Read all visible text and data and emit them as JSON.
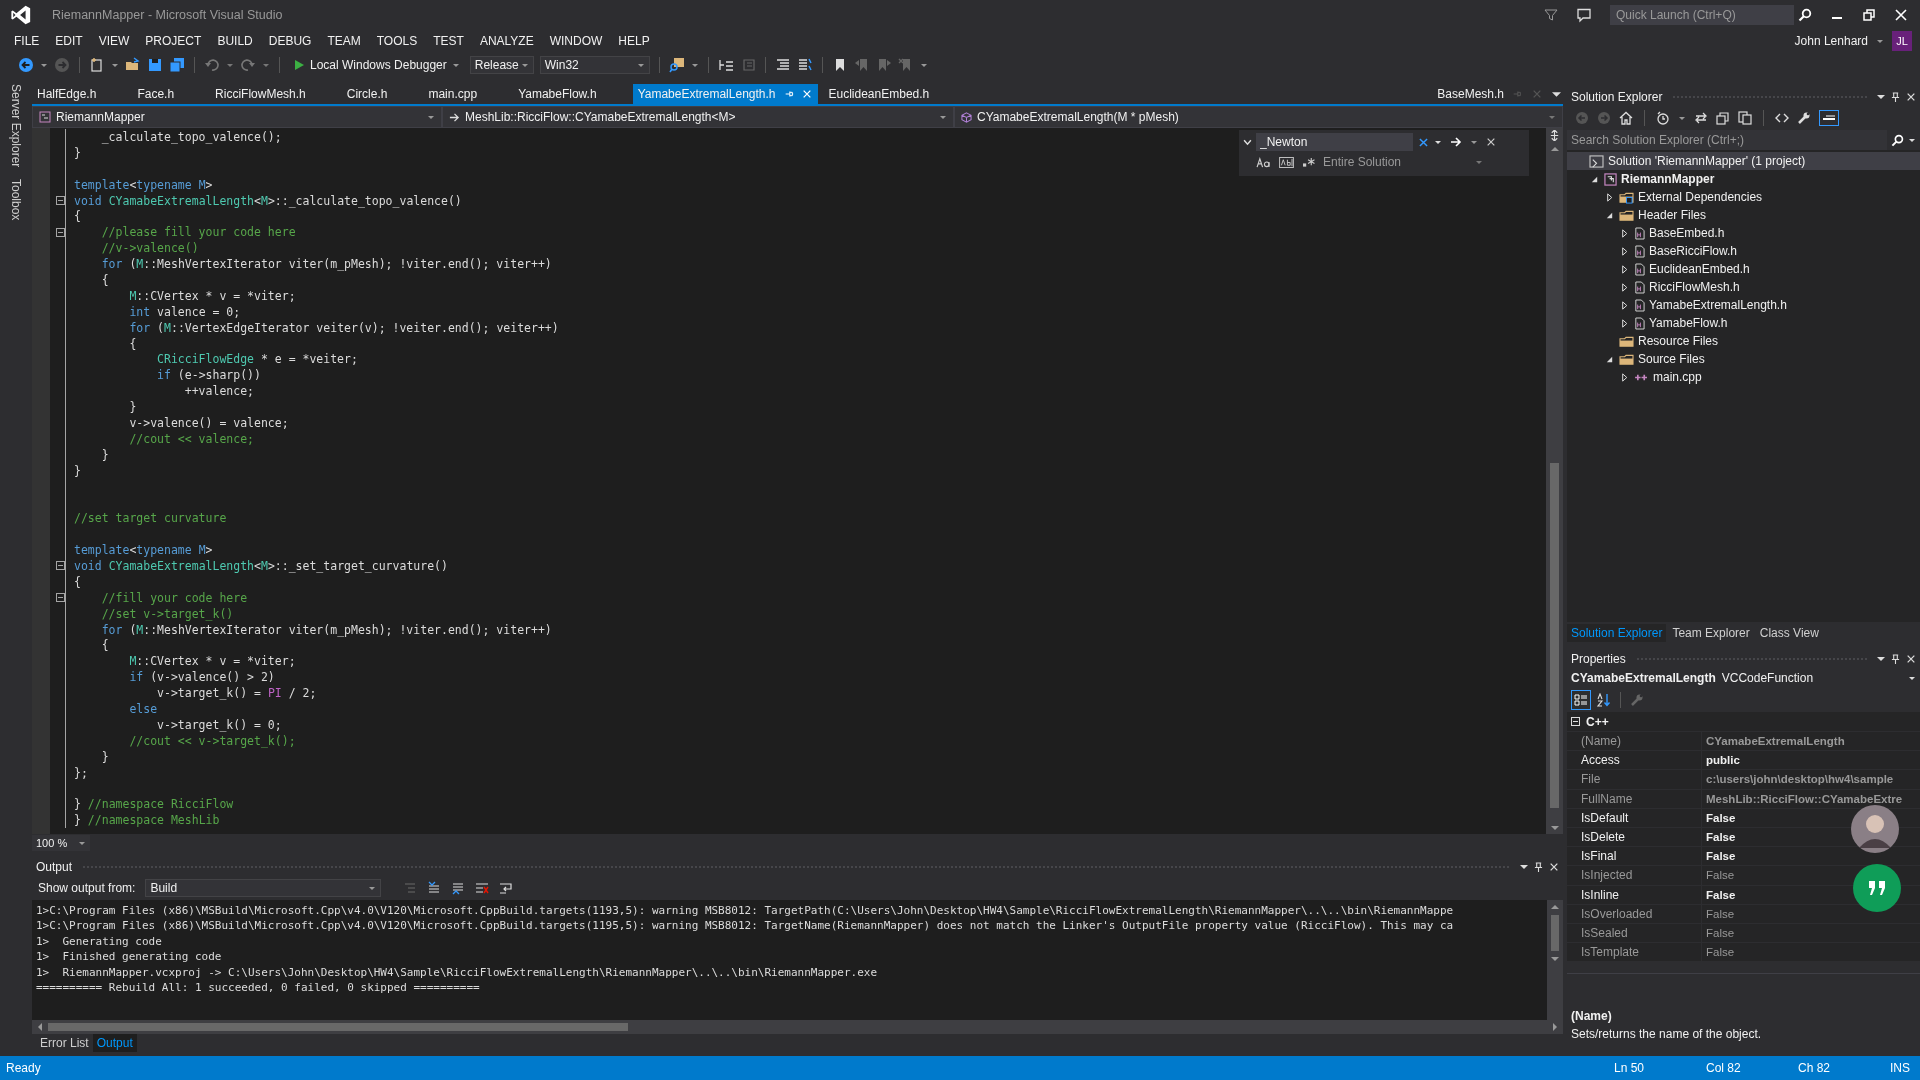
{
  "window": {
    "title": "RiemannMapper - Microsoft Visual Studio"
  },
  "menu": [
    "FILE",
    "EDIT",
    "VIEW",
    "PROJECT",
    "BUILD",
    "DEBUG",
    "TEAM",
    "TOOLS",
    "TEST",
    "ANALYZE",
    "WINDOW",
    "HELP"
  ],
  "toolbar": {
    "debugger": "Local Windows Debugger",
    "configuration": "Release",
    "platform": "Win32"
  },
  "quick_launch": {
    "placeholder": "Quick Launch (Ctrl+Q)"
  },
  "user": {
    "name": "John Lenhard",
    "initials": "JL"
  },
  "side_tabs": [
    "Server Explorer",
    "Toolbox"
  ],
  "editor_tabs": [
    {
      "label": "HalfEdge.h",
      "selected": false
    },
    {
      "label": "Face.h",
      "selected": false
    },
    {
      "label": "RicciFlowMesh.h",
      "selected": false
    },
    {
      "label": "Circle.h",
      "selected": false
    },
    {
      "label": "main.cpp",
      "selected": false
    },
    {
      "label": "YamabeFlow.h",
      "selected": false
    },
    {
      "label": "YamabeExtremalLength.h",
      "selected": true
    },
    {
      "label": "EuclideanEmbed.h",
      "selected": false
    }
  ],
  "preview_tab": {
    "label": "BaseMesh.h"
  },
  "nav_bar": {
    "project": "RiemannMapper",
    "scope": "MeshLib::RicciFlow::CYamabeExtremalLength<M>",
    "member": "CYamabeExtremalLength(M * pMesh)"
  },
  "find": {
    "value": "_Newton",
    "scope": "Entire Solution"
  },
  "code": [
    {
      "fold": false,
      "segs": [
        {
          "text": "    _calculate_topo_valence();",
          "kind": "plain"
        }
      ]
    },
    {
      "fold": false,
      "segs": [
        {
          "text": "}",
          "kind": "plain"
        }
      ]
    },
    {
      "fold": false
    },
    {
      "fold": false,
      "segs": [
        {
          "text": "template",
          "kind": "keyword"
        },
        {
          "text": "<",
          "kind": "plain"
        },
        {
          "text": "typename M",
          "kind": "keyword"
        },
        {
          "text": ">",
          "kind": "plain"
        }
      ]
    },
    {
      "fold": true,
      "segs": [
        {
          "text": "void",
          "kind": "keyword"
        },
        {
          "text": " CYamabeExtremalLength",
          "kind": "type"
        },
        {
          "text": "<",
          "kind": "plain"
        },
        {
          "text": "M",
          "kind": "type"
        },
        {
          "text": ">::_calculate_topo_valence()",
          "kind": "plain"
        }
      ]
    },
    {
      "fold": false,
      "segs": [
        {
          "text": "{",
          "kind": "plain"
        }
      ]
    },
    {
      "fold": true,
      "segs": [
        {
          "text": "    //please fill your code here",
          "kind": "comment"
        }
      ]
    },
    {
      "fold": false,
      "segs": [
        {
          "text": "    //v->valence()",
          "kind": "comment"
        }
      ]
    },
    {
      "fold": false,
      "segs": [
        {
          "text": "    for",
          "kind": "keyword"
        },
        {
          "text": " (",
          "kind": "plain"
        },
        {
          "text": "M",
          "kind": "type"
        },
        {
          "text": "::MeshVertexIterator viter(m_pMesh); !viter.end(); viter++)",
          "kind": "plain"
        }
      ]
    },
    {
      "fold": false,
      "segs": [
        {
          "text": "    {",
          "kind": "plain"
        }
      ]
    },
    {
      "fold": false,
      "segs": [
        {
          "text": "        M",
          "kind": "type"
        },
        {
          "text": "::CVertex * v = *viter;",
          "kind": "plain"
        }
      ]
    },
    {
      "fold": false,
      "segs": [
        {
          "text": "        int",
          "kind": "keyword"
        },
        {
          "text": " valence = 0;",
          "kind": "plain"
        }
      ]
    },
    {
      "fold": false,
      "segs": [
        {
          "text": "        for",
          "kind": "keyword"
        },
        {
          "text": " (",
          "kind": "plain"
        },
        {
          "text": "M",
          "kind": "type"
        },
        {
          "text": "::VertexEdgeIterator veiter(v); !veiter.end(); veiter++)",
          "kind": "plain"
        }
      ]
    },
    {
      "fold": false,
      "segs": [
        {
          "text": "        {",
          "kind": "plain"
        }
      ]
    },
    {
      "fold": false,
      "segs": [
        {
          "text": "            CRicciFlowEdge",
          "kind": "type"
        },
        {
          "text": " * e = *veiter;",
          "kind": "plain"
        }
      ]
    },
    {
      "fold": false,
      "segs": [
        {
          "text": "            if",
          "kind": "keyword"
        },
        {
          "text": " (e->sharp())",
          "kind": "plain"
        }
      ]
    },
    {
      "fold": false,
      "segs": [
        {
          "text": "                ++valence;",
          "kind": "plain"
        }
      ]
    },
    {
      "fold": false,
      "segs": [
        {
          "text": "        }",
          "kind": "plain"
        }
      ]
    },
    {
      "fold": false,
      "segs": [
        {
          "text": "        v->valence() = valence;",
          "kind": "plain"
        }
      ]
    },
    {
      "fold": false,
      "segs": [
        {
          "text": "        //cout << valence;",
          "kind": "comment"
        }
      ]
    },
    {
      "fold": false,
      "segs": [
        {
          "text": "    }",
          "kind": "plain"
        }
      ]
    },
    {
      "fold": false,
      "segs": [
        {
          "text": "}",
          "kind": "plain"
        }
      ]
    },
    {
      "fold": false
    },
    {
      "fold": false
    },
    {
      "fold": false,
      "segs": [
        {
          "text": "//set target curvature",
          "kind": "comment"
        }
      ]
    },
    {
      "fold": false
    },
    {
      "fold": false,
      "segs": [
        {
          "text": "template",
          "kind": "keyword"
        },
        {
          "text": "<",
          "kind": "plain"
        },
        {
          "text": "typename M",
          "kind": "keyword"
        },
        {
          "text": ">",
          "kind": "plain"
        }
      ]
    },
    {
      "fold": true,
      "segs": [
        {
          "text": "void",
          "kind": "keyword"
        },
        {
          "text": " CYamabeExtremalLength",
          "kind": "type"
        },
        {
          "text": "<",
          "kind": "plain"
        },
        {
          "text": "M",
          "kind": "type"
        },
        {
          "text": ">::_set_target_curvature()",
          "kind": "plain"
        }
      ]
    },
    {
      "fold": false,
      "segs": [
        {
          "text": "{",
          "kind": "plain"
        }
      ]
    },
    {
      "fold": true,
      "segs": [
        {
          "text": "    //fill your code here",
          "kind": "comment"
        }
      ]
    },
    {
      "fold": false,
      "segs": [
        {
          "text": "    //set v->target_k()",
          "kind": "comment"
        }
      ]
    },
    {
      "fold": false,
      "segs": [
        {
          "text": "    for",
          "kind": "keyword"
        },
        {
          "text": " (",
          "kind": "plain"
        },
        {
          "text": "M",
          "kind": "type"
        },
        {
          "text": "::MeshVertexIterator viter(m_pMesh); !viter.end(); viter++)",
          "kind": "plain"
        }
      ]
    },
    {
      "fold": false,
      "segs": [
        {
          "text": "    {",
          "kind": "plain"
        }
      ]
    },
    {
      "fold": false,
      "segs": [
        {
          "text": "        M",
          "kind": "type"
        },
        {
          "text": "::CVertex * v = *viter;",
          "kind": "plain"
        }
      ]
    },
    {
      "fold": false,
      "segs": [
        {
          "text": "        if",
          "kind": "keyword"
        },
        {
          "text": " (v->valence() > 2)",
          "kind": "plain"
        }
      ]
    },
    {
      "fold": false,
      "segs": [
        {
          "text": "            v->target_k() = ",
          "kind": "plain"
        },
        {
          "text": "PI",
          "kind": "macro"
        },
        {
          "text": " / 2;",
          "kind": "plain"
        }
      ]
    },
    {
      "fold": false,
      "segs": [
        {
          "text": "        else",
          "kind": "keyword"
        }
      ]
    },
    {
      "fold": false,
      "segs": [
        {
          "text": "            v->target_k() = 0;",
          "kind": "plain"
        }
      ]
    },
    {
      "fold": false,
      "segs": [
        {
          "text": "        //cout << v->target_k();",
          "kind": "comment"
        }
      ]
    },
    {
      "fold": false,
      "segs": [
        {
          "text": "    }",
          "kind": "plain"
        }
      ]
    },
    {
      "fold": false,
      "segs": [
        {
          "text": "};",
          "kind": "plain"
        }
      ]
    },
    {
      "fold": false
    },
    {
      "fold": false,
      "segs": [
        {
          "text": "} ",
          "kind": "plain"
        },
        {
          "text": "//namespace RicciFlow",
          "kind": "comment"
        }
      ]
    },
    {
      "fold": false,
      "segs": [
        {
          "text": "} ",
          "kind": "plain"
        },
        {
          "text": "//namespace MeshLib",
          "kind": "comment"
        }
      ]
    }
  ],
  "zoom": "100 %",
  "output": {
    "title": "Output",
    "source_label": "Show output from:",
    "source": "Build",
    "lines": [
      "1>C:\\Program Files (x86)\\MSBuild\\Microsoft.Cpp\\v4.0\\V120\\Microsoft.CppBuild.targets(1193,5): warning MSB8012: TargetPath(C:\\Users\\John\\Desktop\\HW4\\Sample\\RicciFlowExtremalLength\\RiemannMapper\\..\\..\\bin\\RiemannMappe",
      "1>C:\\Program Files (x86)\\MSBuild\\Microsoft.Cpp\\v4.0\\V120\\Microsoft.CppBuild.targets(1195,5): warning MSB8012: TargetName(RiemannMapper) does not match the Linker's OutputFile property value (RicciFlow). This may ca",
      "1>  Generating code",
      "1>  Finished generating code",
      "1>  RiemannMapper.vcxproj -> C:\\Users\\John\\Desktop\\HW4\\Sample\\RicciFlowExtremalLength\\RiemannMapper\\..\\..\\bin\\RiemannMapper.exe",
      "========== Rebuild All: 1 succeeded, 0 failed, 0 skipped =========="
    ]
  },
  "bottom_tabs": [
    {
      "label": "Error List",
      "selected": false
    },
    {
      "label": "Output",
      "selected": true
    }
  ],
  "solution_explorer": {
    "title": "Solution Explorer",
    "search": {
      "placeholder": "Search Solution Explorer (Ctrl+;)"
    },
    "tree": [
      {
        "label": "Solution 'RiemannMapper' (1 project)",
        "kind": "solution",
        "children": [
          {
            "label": "RiemannMapper",
            "kind": "project",
            "expanded": true,
            "children": [
              {
                "label": "External Dependencies",
                "kind": "deps",
                "expanded": false
              },
              {
                "label": "Header Files",
                "kind": "folder",
                "expanded": true,
                "children": [
                  {
                    "label": "BaseEmbed.h",
                    "kind": "header",
                    "expanded": false
                  },
                  {
                    "label": "BaseRicciFlow.h",
                    "kind": "header",
                    "expanded": false
                  },
                  {
                    "label": "EuclideanEmbed.h",
                    "kind": "header",
                    "expanded": false
                  },
                  {
                    "label": "RicciFlowMesh.h",
                    "kind": "header",
                    "expanded": false
                  },
                  {
                    "label": "YamabeExtremalLength.h",
                    "kind": "header",
                    "expanded": false
                  },
                  {
                    "label": "YamabeFlow.h",
                    "kind": "header",
                    "expanded": false
                  }
                ]
              },
              {
                "label": "Resource Files",
                "kind": "folder"
              },
              {
                "label": "Source Files",
                "kind": "folder",
                "expanded": true,
                "children": [
                  {
                    "label": "main.cpp",
                    "kind": "cpp",
                    "expanded": false
                  }
                ]
              }
            ]
          }
        ]
      }
    ]
  },
  "right_tabs": [
    {
      "label": "Solution Explorer",
      "selected": true
    },
    {
      "label": "Team Explorer",
      "selected": false
    },
    {
      "label": "Class View",
      "selected": false
    }
  ],
  "properties": {
    "title": "Properties",
    "object": "CYamabeExtremalLength",
    "object_type": "VCCodeFunction",
    "category": {
      "label": "C++",
      "expanded": true
    },
    "rows": [
      {
        "name": "(Name)",
        "value": "CYamabeExtremalLength",
        "readonly": true,
        "bold": true
      },
      {
        "name": "Access",
        "value": "public",
        "readonly": false,
        "bold": true
      },
      {
        "name": "File",
        "value": "c:\\users\\john\\desktop\\hw4\\sample",
        "readonly": true,
        "bold": true
      },
      {
        "name": "FullName",
        "value": "MeshLib::RicciFlow::CYamabeExtre",
        "readonly": true,
        "bold": true
      },
      {
        "name": "IsDefault",
        "value": "False",
        "readonly": false,
        "bold": true
      },
      {
        "name": "IsDelete",
        "value": "False",
        "readonly": false,
        "bold": true
      },
      {
        "name": "IsFinal",
        "value": "False",
        "readonly": false,
        "bold": true
      },
      {
        "name": "IsInjected",
        "value": "False",
        "readonly": true,
        "bold": false
      },
      {
        "name": "IsInline",
        "value": "False",
        "readonly": false,
        "bold": true
      },
      {
        "name": "IsOverloaded",
        "value": "False",
        "readonly": true,
        "bold": false
      },
      {
        "name": "IsSealed",
        "value": "False",
        "readonly": true,
        "bold": false
      },
      {
        "name": "IsTemplate",
        "value": "False",
        "readonly": true,
        "bold": false
      }
    ],
    "description": {
      "title": "(Name)",
      "text": "Sets/returns the name of the object."
    }
  },
  "status_bar": {
    "message": "Ready",
    "line": "Ln 50",
    "column": "Col 82",
    "char": "Ch 82",
    "mode": "INS"
  }
}
